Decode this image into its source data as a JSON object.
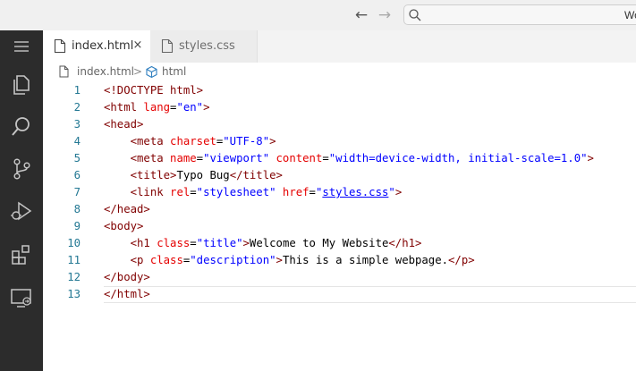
{
  "window": {
    "search_text": "Wo"
  },
  "activity_bar": {
    "icons": [
      "menu-icon",
      "explorer-icon",
      "search-icon",
      "source-control-icon",
      "run-debug-icon",
      "extensions-icon",
      "remote-explorer-icon"
    ]
  },
  "tabs": [
    {
      "label": "index.html",
      "close": "×",
      "active": true
    },
    {
      "label": "styles.css",
      "active": false
    }
  ],
  "breadcrumb": {
    "file": "index.html",
    "separator": ">",
    "symbol": "html"
  },
  "colors": {
    "activity_bar": "#2c2c2c",
    "tag": "#800000",
    "attribute": "#e50000",
    "string": "#0000ff",
    "line_number": "#237893"
  },
  "editor": {
    "current_line": 13,
    "lines": [
      {
        "num": "1",
        "tokens": [
          {
            "t": "p",
            "v": "<!DOCTYPE html>"
          }
        ]
      },
      {
        "num": "2",
        "tokens": [
          {
            "t": "p",
            "v": "<html "
          },
          {
            "t": "a",
            "v": "lang"
          },
          {
            "t": "t",
            "v": "="
          },
          {
            "t": "s",
            "v": "\"en\""
          },
          {
            "t": "p",
            "v": ">"
          }
        ]
      },
      {
        "num": "3",
        "tokens": [
          {
            "t": "p",
            "v": "<head>"
          }
        ]
      },
      {
        "num": "4",
        "tokens": [
          {
            "t": "t",
            "v": "    "
          },
          {
            "t": "p",
            "v": "<meta "
          },
          {
            "t": "a",
            "v": "charset"
          },
          {
            "t": "t",
            "v": "="
          },
          {
            "t": "s",
            "v": "\"UTF-8\""
          },
          {
            "t": "p",
            "v": ">"
          }
        ]
      },
      {
        "num": "5",
        "tokens": [
          {
            "t": "t",
            "v": "    "
          },
          {
            "t": "p",
            "v": "<meta "
          },
          {
            "t": "a",
            "v": "name"
          },
          {
            "t": "t",
            "v": "="
          },
          {
            "t": "s",
            "v": "\"viewport\""
          },
          {
            "t": "t",
            "v": " "
          },
          {
            "t": "a",
            "v": "content"
          },
          {
            "t": "t",
            "v": "="
          },
          {
            "t": "s",
            "v": "\"width=device-width, initial-scale=1.0\""
          },
          {
            "t": "p",
            "v": ">"
          }
        ]
      },
      {
        "num": "6",
        "tokens": [
          {
            "t": "t",
            "v": "    "
          },
          {
            "t": "p",
            "v": "<title>"
          },
          {
            "t": "t",
            "v": "Typo Bug"
          },
          {
            "t": "p",
            "v": "</title>"
          }
        ]
      },
      {
        "num": "7",
        "tokens": [
          {
            "t": "t",
            "v": "    "
          },
          {
            "t": "p",
            "v": "<link "
          },
          {
            "t": "a",
            "v": "rel"
          },
          {
            "t": "t",
            "v": "="
          },
          {
            "t": "s",
            "v": "\"stylesheet\""
          },
          {
            "t": "t",
            "v": " "
          },
          {
            "t": "a",
            "v": "href"
          },
          {
            "t": "t",
            "v": "="
          },
          {
            "t": "s",
            "v": "\""
          },
          {
            "t": "l",
            "v": "styles.css"
          },
          {
            "t": "s",
            "v": "\""
          },
          {
            "t": "p",
            "v": ">"
          }
        ]
      },
      {
        "num": "8",
        "tokens": [
          {
            "t": "p",
            "v": "</head>"
          }
        ]
      },
      {
        "num": "9",
        "tokens": [
          {
            "t": "p",
            "v": "<body>"
          }
        ]
      },
      {
        "num": "10",
        "tokens": [
          {
            "t": "t",
            "v": "    "
          },
          {
            "t": "p",
            "v": "<h1 "
          },
          {
            "t": "a",
            "v": "class"
          },
          {
            "t": "t",
            "v": "="
          },
          {
            "t": "s",
            "v": "\"title\""
          },
          {
            "t": "p",
            "v": ">"
          },
          {
            "t": "t",
            "v": "Welcome to My Website"
          },
          {
            "t": "p",
            "v": "</h1>"
          }
        ]
      },
      {
        "num": "11",
        "tokens": [
          {
            "t": "t",
            "v": "    "
          },
          {
            "t": "p",
            "v": "<p "
          },
          {
            "t": "a",
            "v": "class"
          },
          {
            "t": "t",
            "v": "="
          },
          {
            "t": "s",
            "v": "\"description\""
          },
          {
            "t": "p",
            "v": ">"
          },
          {
            "t": "t",
            "v": "This is a simple webpage."
          },
          {
            "t": "p",
            "v": "</p>"
          }
        ]
      },
      {
        "num": "12",
        "tokens": [
          {
            "t": "p",
            "v": "</body>"
          }
        ]
      },
      {
        "num": "13",
        "tokens": [
          {
            "t": "p",
            "v": "</html>"
          }
        ]
      }
    ]
  }
}
